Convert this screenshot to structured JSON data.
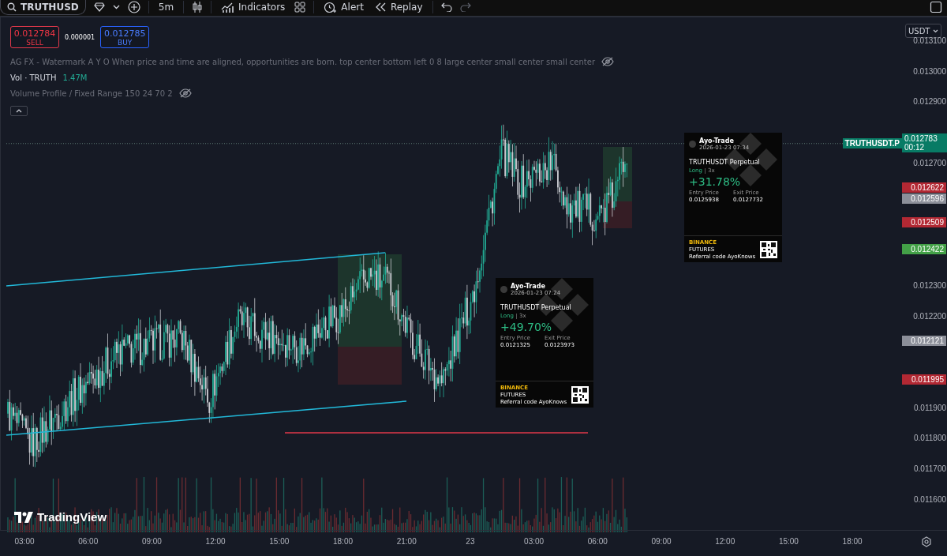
{
  "toolbar": {
    "symbol": "TRUTHUSD",
    "interval": "5m",
    "indicators": "Indicators",
    "alert": "Alert",
    "replay": "Replay"
  },
  "trade_widget": {
    "sell_price": "0.012784",
    "sell": "SELL",
    "spread": "0.000001",
    "buy_price": "0.012785",
    "buy": "BUY"
  },
  "legend": [
    {
      "kind": "text",
      "label": "AG FX - Watermark A Y O When price and time are aligned, opportunities are born. top center bottom left 0 8 large center small center small center",
      "hidden": true
    },
    {
      "kind": "volume",
      "label": "Vol · TRUTH",
      "value": "1.47M"
    },
    {
      "kind": "text",
      "label": "Volume Profile / Fixed Range 150 24 70 2",
      "hidden": true
    }
  ],
  "currency": "USDT",
  "price_axis": {
    "ticks": [
      "0.013100",
      "0.013000",
      "0.012900",
      "0.012700",
      "0.012300",
      "0.012200",
      "0.011900",
      "0.011800",
      "0.011700",
      "0.011600"
    ],
    "tags": [
      {
        "text": "0.012622",
        "color": "#b22833"
      },
      {
        "text": "0.012596",
        "color": "#8c8f99"
      },
      {
        "text": "0.012509",
        "color": "#b22833"
      },
      {
        "text": "0.012422",
        "color": "#43a047"
      },
      {
        "text": "0.012121",
        "color": "#8c8f99"
      },
      {
        "text": "0.011995",
        "color": "#b22833"
      }
    ],
    "last_price": {
      "symbol": "TRUTHUSDT.P",
      "price": "0.012783",
      "countdown": "00:12"
    }
  },
  "trade_cards": [
    {
      "user": "Ayo-Trade",
      "date": "2026-01-23 07:34",
      "pair": "TRUTHUSDT Perpetual",
      "side": "Long",
      "leverage": "3x",
      "pnl": "+31.78%",
      "entry_label": "Entry Price",
      "entry": "0.0125938",
      "exit_label": "Exit Price",
      "exit": "0.0127732",
      "brand": "BINANCE",
      "product": "FUTURES",
      "referral": "Referral code AyoKnows"
    },
    {
      "user": "Ayo-Trade",
      "date": "2026-01-23 07:24",
      "pair": "TRUTHUSDT Perpetual",
      "side": "Long",
      "leverage": "3x",
      "pnl": "+49.70%",
      "entry_label": "Entry Price",
      "entry": "0.0121325",
      "exit_label": "Exit Price",
      "exit": "0.0123973",
      "brand": "BINANCE",
      "product": "FUTURES",
      "referral": "Referral code AyoKnows"
    }
  ],
  "logo": "TradingView",
  "time_axis": [
    "03:00",
    "06:00",
    "09:00",
    "12:00",
    "15:00",
    "18:00",
    "21:00",
    "23",
    "03:00",
    "06:00",
    "09:00",
    "12:00",
    "15:00",
    "18:00"
  ]
}
